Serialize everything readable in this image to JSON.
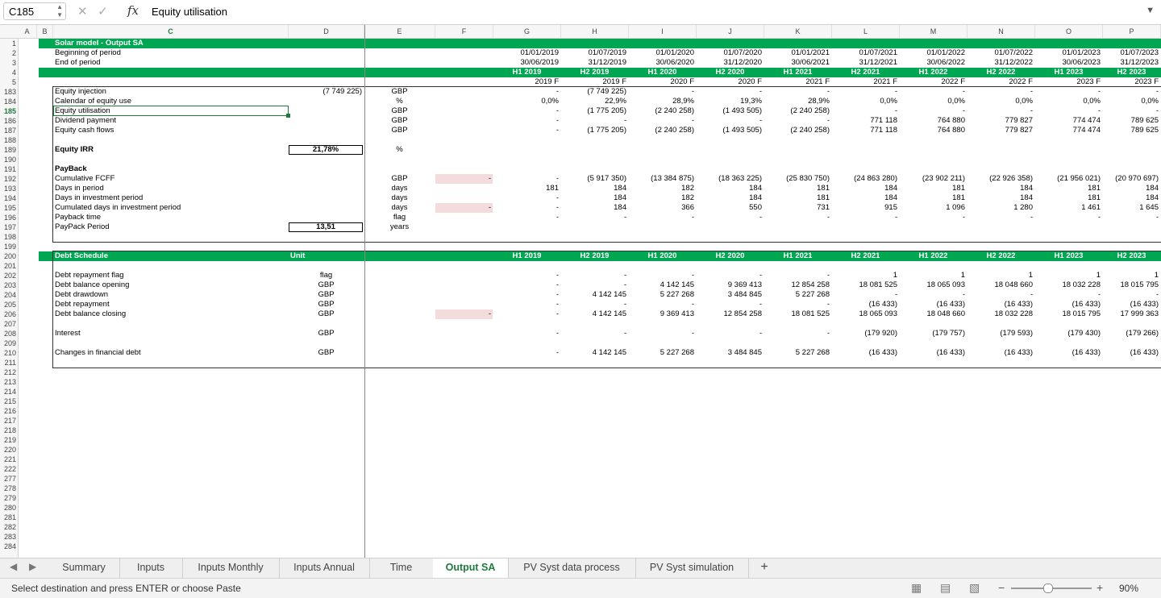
{
  "formula_bar": {
    "cell_ref": "C185",
    "fx": "fx",
    "value": "Equity utilisation"
  },
  "columns": [
    "A",
    "B",
    "C",
    "D",
    "E",
    "F",
    "G",
    "H",
    "I",
    "J",
    "K",
    "L",
    "M",
    "N",
    "O",
    "P"
  ],
  "rows": [
    "1",
    "2",
    "3",
    "4",
    "5",
    "183",
    "184",
    "185",
    "186",
    "187",
    "188",
    "189",
    "190",
    "191",
    "192",
    "193",
    "194",
    "195",
    "196",
    "197",
    "198",
    "199",
    "200",
    "201",
    "202",
    "203",
    "204",
    "205",
    "206",
    "207",
    "208",
    "209",
    "210",
    "211",
    "212",
    "213",
    "214",
    "215",
    "216",
    "217",
    "218",
    "219",
    "220",
    "221",
    "222",
    "277",
    "278",
    "279",
    "280",
    "281",
    "282",
    "283",
    "284"
  ],
  "header": {
    "title": "Solar model - Output SA",
    "begin_label": "Beginning of period",
    "end_label": "End of period",
    "begin_dates": [
      "01/01/2019",
      "01/07/2019",
      "01/01/2020",
      "01/07/2020",
      "01/01/2021",
      "01/07/2021",
      "01/01/2022",
      "01/07/2022",
      "01/01/2023",
      "01/07/2023"
    ],
    "end_dates": [
      "30/06/2019",
      "31/12/2019",
      "30/06/2020",
      "31/12/2020",
      "30/06/2021",
      "31/12/2021",
      "30/06/2022",
      "31/12/2022",
      "30/06/2023",
      "31/12/2023"
    ],
    "halves": [
      "H1 2019",
      "H2 2019",
      "H1 2020",
      "H2 2020",
      "H1 2021",
      "H2 2021",
      "H1 2022",
      "H2 2022",
      "H1 2023",
      "H2 2023"
    ],
    "years": [
      "2019 F",
      "2019 F",
      "2020 F",
      "2020 F",
      "2021 F",
      "2021 F",
      "2022 F",
      "2022 F",
      "2023 F",
      "2023 F"
    ]
  },
  "equity": [
    {
      "label": "Equity injection",
      "d": "(7 749 225)",
      "unit": "GBP",
      "g": "-",
      "vals": [
        "(7 749 225)",
        "-",
        "-",
        "-",
        "-",
        "-",
        "-",
        "-",
        "-"
      ]
    },
    {
      "label": "Calendar of equity use",
      "d": "",
      "unit": "%",
      "g": "0,0%",
      "vals": [
        "22,9%",
        "28,9%",
        "19,3%",
        "28,9%",
        "0,0%",
        "0,0%",
        "0,0%",
        "0,0%",
        "0,0%"
      ]
    },
    {
      "label": "Equity utilisation",
      "d": "",
      "unit": "GBP",
      "g": "-",
      "vals": [
        "(1 775 205)",
        "(2 240 258)",
        "(1 493 505)",
        "(2 240 258)",
        "-",
        "-",
        "-",
        "-",
        "-"
      ]
    },
    {
      "label": "Dividend payment",
      "d": "",
      "unit": "GBP",
      "g": "-",
      "vals": [
        "-",
        "-",
        "-",
        "-",
        "771 118",
        "764 880",
        "779 827",
        "774 474",
        "789 625"
      ]
    },
    {
      "label": "Equity cash flows",
      "d": "",
      "unit": "GBP",
      "g": "-",
      "vals": [
        "(1 775 205)",
        "(2 240 258)",
        "(1 493 505)",
        "(2 240 258)",
        "771 118",
        "764 880",
        "779 827",
        "774 474",
        "789 625"
      ]
    }
  ],
  "irr": {
    "label": "Equity IRR",
    "value": "21,78%",
    "unit": "%"
  },
  "payback": {
    "title": "PayBack",
    "rows": [
      {
        "label": "Cumulative FCFF",
        "unit": "GBP",
        "f": "-",
        "g": "-",
        "vals": [
          "(5 917 350)",
          "(13 384 875)",
          "(18 363 225)",
          "(25 830 750)",
          "(24 863 280)",
          "(23 902 211)",
          "(22 926 358)",
          "(21 956 021)",
          "(20 970 697)"
        ]
      },
      {
        "label": "Days in period",
        "unit": "days",
        "f": "",
        "g": "181",
        "vals": [
          "184",
          "182",
          "184",
          "181",
          "184",
          "181",
          "184",
          "181",
          "184"
        ]
      },
      {
        "label": "Days in investment period",
        "unit": "days",
        "f": "",
        "g": "-",
        "vals": [
          "184",
          "182",
          "184",
          "181",
          "184",
          "181",
          "184",
          "181",
          "184"
        ]
      },
      {
        "label": "Cumulated days in investment period",
        "unit": "days",
        "f": "-",
        "g": "-",
        "vals": [
          "184",
          "366",
          "550",
          "731",
          "915",
          "1 096",
          "1 280",
          "1 461",
          "1 645"
        ]
      },
      {
        "label": "Payback time",
        "unit": "flag",
        "f": "",
        "g": "-",
        "vals": [
          "-",
          "-",
          "-",
          "-",
          "-",
          "-",
          "-",
          "-",
          "-"
        ]
      },
      {
        "label": "PayPack Period",
        "unit": "years",
        "f": "",
        "g": "",
        "vals": []
      }
    ],
    "period_value": "13,51"
  },
  "debt": {
    "title": "Debt Schedule",
    "unit_label": "Unit",
    "rows": [
      {
        "label": "Debt repayment flag",
        "unit": "flag",
        "f": "",
        "g": "-",
        "vals": [
          "-",
          "-",
          "-",
          "-",
          "1",
          "1",
          "1",
          "1",
          "1"
        ]
      },
      {
        "label": "Debt balance opening",
        "unit": "GBP",
        "f": "",
        "g": "-",
        "vals": [
          "-",
          "4 142 145",
          "9 369 413",
          "12 854 258",
          "18 081 525",
          "18 065 093",
          "18 048 660",
          "18 032 228",
          "18 015 795"
        ]
      },
      {
        "label": "Debt drawdown",
        "unit": "GBP",
        "f": "",
        "g": "-",
        "vals": [
          "4 142 145",
          "5 227 268",
          "3 484 845",
          "5 227 268",
          "-",
          "-",
          "-",
          "-",
          "-"
        ]
      },
      {
        "label": "Debt repayment",
        "unit": "GBP",
        "f": "",
        "g": "-",
        "vals": [
          "-",
          "-",
          "-",
          "-",
          "(16 433)",
          "(16 433)",
          "(16 433)",
          "(16 433)",
          "(16 433)"
        ]
      },
      {
        "label": "Debt balance closing",
        "unit": "GBP",
        "f": "-",
        "g": "-",
        "vals": [
          "4 142 145",
          "9 369 413",
          "12 854 258",
          "18 081 525",
          "18 065 093",
          "18 048 660",
          "18 032 228",
          "18 015 795",
          "17 999 363"
        ]
      },
      {
        "label": "Interest",
        "unit": "GBP",
        "f": "",
        "g": "-",
        "vals": [
          "-",
          "-",
          "-",
          "-",
          "(179 920)",
          "(179 757)",
          "(179 593)",
          "(179 430)",
          "(179 266)"
        ]
      },
      {
        "label": "Changes in financial debt",
        "unit": "GBP",
        "f": "",
        "g": "-",
        "vals": [
          "4 142 145",
          "5 227 268",
          "3 484 845",
          "5 227 268",
          "(16 433)",
          "(16 433)",
          "(16 433)",
          "(16 433)",
          "(16 433)"
        ]
      }
    ]
  },
  "tabs": [
    "Summary",
    "Inputs",
    "Inputs Monthly",
    "Inputs Annual",
    "Time",
    "Output SA",
    "PV Syst data process",
    "PV Syst simulation",
    "+"
  ],
  "active_tab": "Output SA",
  "status": {
    "message": "Select destination and press ENTER or choose Paste",
    "zoom": "90%"
  }
}
